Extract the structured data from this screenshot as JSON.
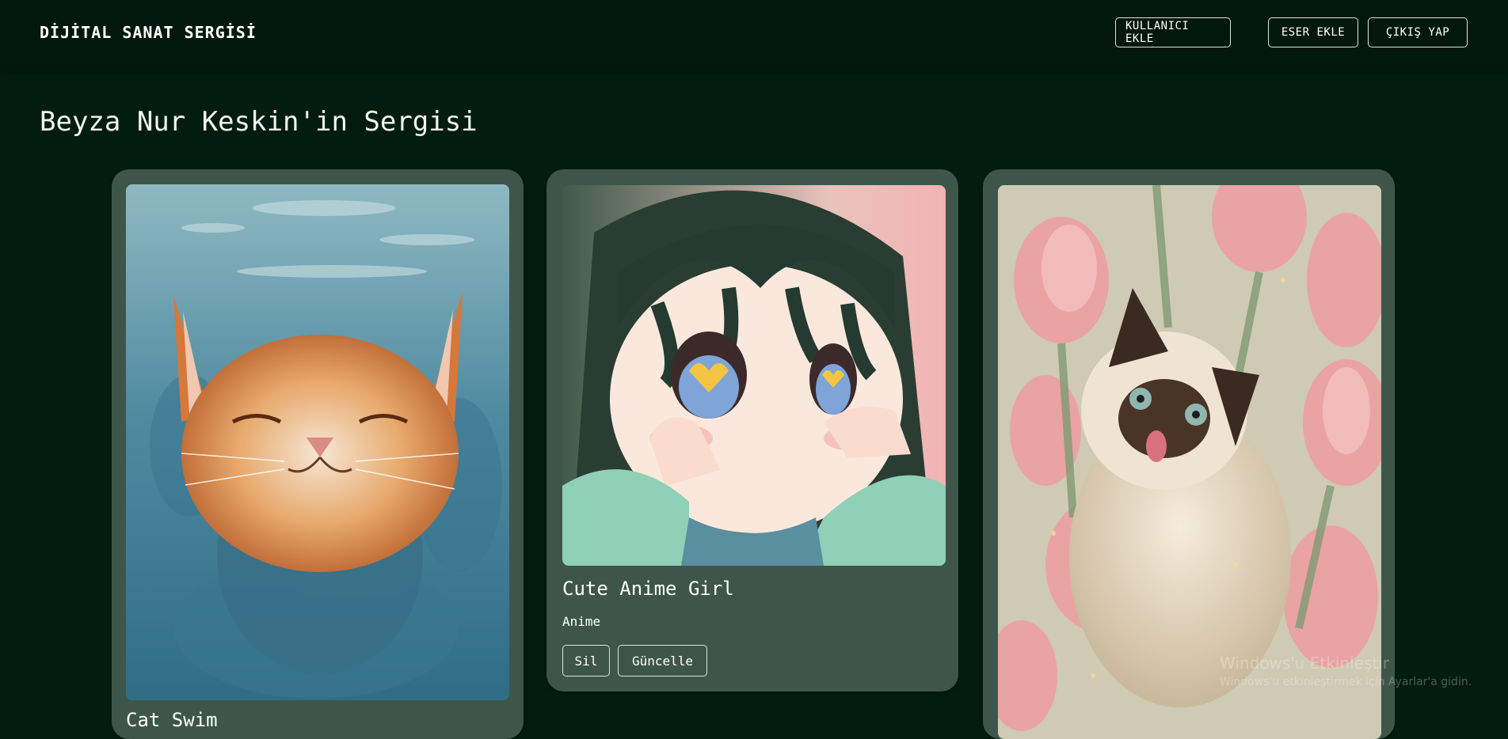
{
  "header": {
    "brand": "DİJİTAL SANAT SERGİSİ",
    "buttons": {
      "add_user": "KULLANICI EKLE",
      "add_artwork": "ESER EKLE",
      "logout": "ÇIKIŞ YAP"
    }
  },
  "page": {
    "title": "Beyza Nur Keskin'in Sergisi"
  },
  "artworks": [
    {
      "title": "Cat Swim",
      "image_subject": "orange-kitten-swimming-painting"
    },
    {
      "title": "Cute Anime Girl",
      "category": "Anime",
      "delete_label": "Sil",
      "update_label": "Güncelle",
      "image_subject": "anime-girl-heart-eyes-illustration"
    },
    {
      "title": "",
      "image_subject": "siamese-cat-pink-tulips-painting"
    }
  ],
  "colors": {
    "background": "#021d10",
    "navbar": "#02170e",
    "card": "#3e564a",
    "button_border": "#d8e6dc"
  },
  "watermark": {
    "title": "Windows'u Etkinleştir",
    "text": "Windows'u etkinleştirmek için Ayarlar'a gidin."
  }
}
